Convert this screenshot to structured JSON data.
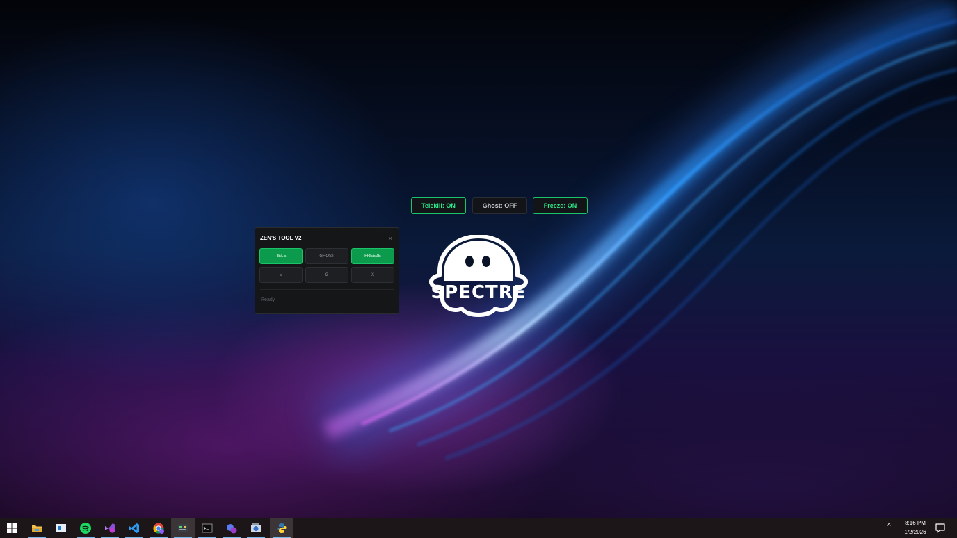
{
  "desktop": {
    "logo_text": "SPECTRE",
    "status_pills": [
      {
        "label": "Telekill: ON",
        "state": "on"
      },
      {
        "label": "Ghost: OFF",
        "state": "off"
      },
      {
        "label": "Freeze: ON",
        "state": "on"
      }
    ]
  },
  "tool_window": {
    "title": "ZEN'S TOOL V2",
    "close_glyph": "×",
    "buttons_row1": [
      {
        "label": "TELE",
        "active": true
      },
      {
        "label": "GHOST",
        "active": false
      },
      {
        "label": "FREEZE",
        "active": true
      }
    ],
    "buttons_row2": [
      {
        "label": "V",
        "active": false
      },
      {
        "label": "G",
        "active": false
      },
      {
        "label": "X",
        "active": false
      }
    ],
    "status": "Ready"
  },
  "taskbar": {
    "apps": [
      {
        "name": "start",
        "icon": "windows-logo-icon"
      },
      {
        "name": "file-explorer",
        "icon": "folder-icon"
      },
      {
        "name": "app-window",
        "icon": "window-icon"
      },
      {
        "name": "spotify",
        "icon": "spotify-icon"
      },
      {
        "name": "visual-studio",
        "icon": "visual-studio-icon"
      },
      {
        "name": "vscode",
        "icon": "vscode-icon"
      },
      {
        "name": "chrome",
        "icon": "chrome-icon"
      },
      {
        "name": "app-terminal-1",
        "icon": "app-icon"
      },
      {
        "name": "terminal",
        "icon": "terminal-icon"
      },
      {
        "name": "app-purple",
        "icon": "app-icon"
      },
      {
        "name": "app-tools",
        "icon": "app-icon"
      },
      {
        "name": "python",
        "icon": "python-icon"
      }
    ],
    "clock": {
      "time": "8:16 PM",
      "date": "1/2/2026"
    },
    "tray_chevron": "^"
  },
  "colors": {
    "accent_green": "#0c9b4c",
    "pill_on_text": "#2ee889",
    "taskbar_bg": "#1d1618"
  }
}
